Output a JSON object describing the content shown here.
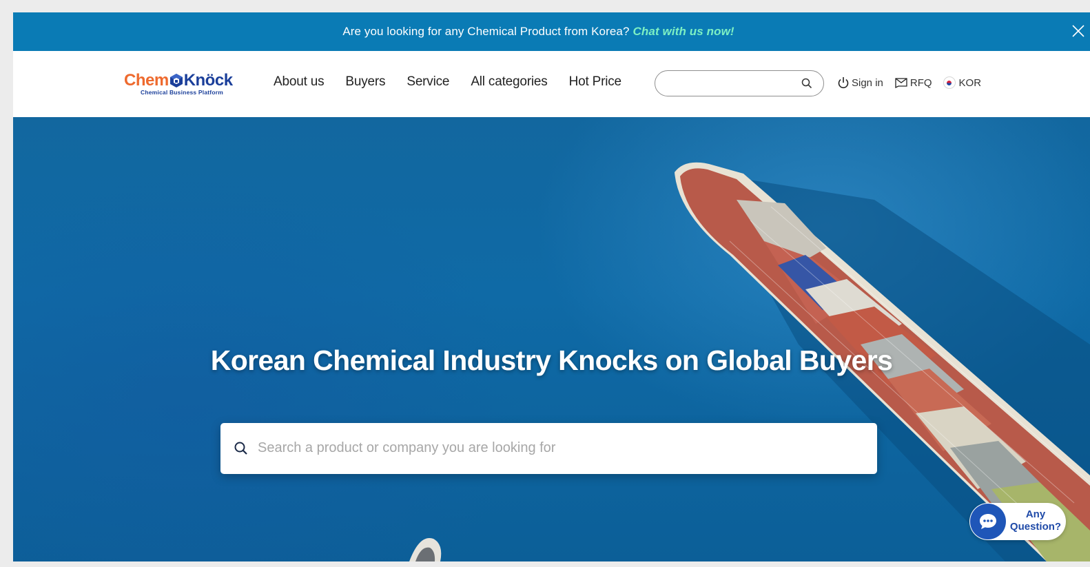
{
  "announcement": {
    "message": "Are you looking for any Chemical Product from Korea?",
    "cta": "Chat with us now!",
    "close_icon": "close-icon"
  },
  "logo": {
    "chem": "Chem",
    "knock": "Knöck",
    "tagline": "Chemical Business Platform"
  },
  "nav": {
    "items": [
      {
        "label": "About us"
      },
      {
        "label": "Buyers"
      },
      {
        "label": "Service"
      },
      {
        "label": "All categories"
      },
      {
        "label": "Hot Price"
      }
    ]
  },
  "header_search": {
    "value": "",
    "placeholder": "",
    "icon": "search-icon"
  },
  "utilities": {
    "sign_in": "Sign in",
    "rfq": "RFQ",
    "language": "KOR"
  },
  "hero": {
    "title": "Korean Chemical Industry Knocks on Global Buyers",
    "search_placeholder": "Search a product or company you are looking for",
    "search_value": ""
  },
  "chat_widget": {
    "line1": "Any",
    "line2": "Question?"
  },
  "colors": {
    "topbar": "#0a7bb5",
    "cta": "#7df0c3",
    "brand_orange": "#ee6a2e",
    "brand_blue": "#1b3f9a",
    "hero_blue": "#0f6aa6",
    "chat_blue": "#1f56b8"
  }
}
